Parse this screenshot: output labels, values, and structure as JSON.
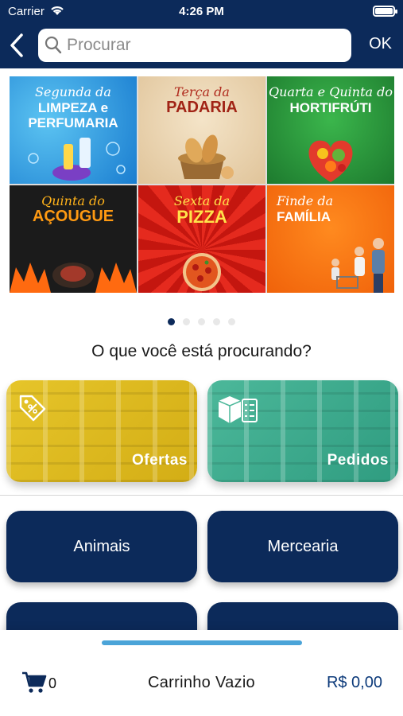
{
  "status_bar": {
    "carrier": "Carrier",
    "time": "4:26 PM"
  },
  "header": {
    "search_placeholder": "Procurar",
    "ok_label": "OK"
  },
  "banner": {
    "tiles": [
      {
        "small": "Segunda da",
        "big": "LIMPEZA e PERFUMARIA"
      },
      {
        "small": "Terça da",
        "big": "PADARIA"
      },
      {
        "small": "Quarta e Quinta do",
        "big": "HORTIFRÚTI"
      },
      {
        "small": "Quinta do",
        "big": "AÇOUGUE"
      },
      {
        "small": "Sexta da",
        "big": "PIZZA"
      },
      {
        "small": "Finde da",
        "big": "FAMÍLIA"
      }
    ],
    "page_count": 5,
    "active_page": 1
  },
  "question": "O que você está procurando?",
  "cards": {
    "offers_label": "Ofertas",
    "orders_label": "Pedidos"
  },
  "departments": [
    "Animais",
    "Mercearia",
    "",
    ""
  ],
  "cart": {
    "count": "0",
    "status": "Carrinho Vazio",
    "total": "R$ 0,00"
  },
  "colors": {
    "primary": "#0c2a5a",
    "offers": "#e6c52a",
    "orders": "#4cb89a",
    "handle": "#4ba4d8",
    "total": "#0c3a7a"
  },
  "icons": [
    "back-chevron-icon",
    "search-icon",
    "wifi-icon",
    "battery-icon",
    "price-tag-icon",
    "boxes-checklist-icon",
    "cart-icon"
  ]
}
